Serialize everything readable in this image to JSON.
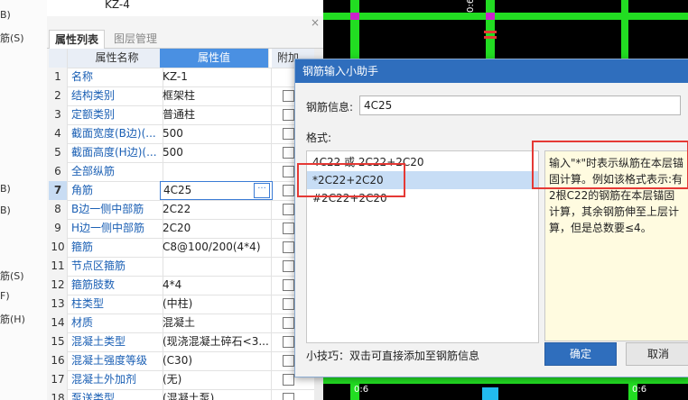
{
  "left_strip": [
    "B)",
    "筋(S)",
    "B)",
    "B)",
    "筋(S)",
    "F)",
    "筋(H)"
  ],
  "panel": {
    "top_item": "KZ-4",
    "close_glyph": "×",
    "tabs": [
      {
        "label": "属性列表"
      },
      {
        "label": "图层管理"
      }
    ],
    "header": {
      "name": "属性名称",
      "value": "属性值",
      "extra": "附加"
    },
    "rows": [
      {
        "num": "1",
        "name": "名称",
        "value": "KZ-1",
        "check": false
      },
      {
        "num": "2",
        "name": "结构类别",
        "value": "框架柱",
        "check": true
      },
      {
        "num": "3",
        "name": "定额类别",
        "value": "普通柱",
        "check": true
      },
      {
        "num": "4",
        "name": "截面宽度(B边)(...",
        "value": "500",
        "check": true
      },
      {
        "num": "5",
        "name": "截面高度(H边)(...",
        "value": "500",
        "check": true
      },
      {
        "num": "6",
        "name": "全部纵筋",
        "value": "",
        "check": true
      },
      {
        "num": "7",
        "name": "角筋",
        "value": "4C25",
        "check": true
      },
      {
        "num": "8",
        "name": "B边一侧中部筋",
        "value": "2C22",
        "check": true
      },
      {
        "num": "9",
        "name": "H边一侧中部筋",
        "value": "2C20",
        "check": true
      },
      {
        "num": "10",
        "name": "箍筋",
        "value": "C8@100/200(4*4)",
        "check": true
      },
      {
        "num": "11",
        "name": "节点区箍筋",
        "value": "",
        "check": true
      },
      {
        "num": "12",
        "name": "箍筋肢数",
        "value": "4*4",
        "check": true
      },
      {
        "num": "13",
        "name": "柱类型",
        "value": "(中柱)",
        "check": true
      },
      {
        "num": "14",
        "name": "材质",
        "value": "混凝土",
        "check": true
      },
      {
        "num": "15",
        "name": "混凝土类型",
        "value": "(现浇混凝土碎石<3...",
        "check": true
      },
      {
        "num": "16",
        "name": "混凝土强度等级",
        "value": "(C30)",
        "check": true
      },
      {
        "num": "17",
        "name": "混凝土外加剂",
        "value": "(无)",
        "check": true
      },
      {
        "num": "18",
        "name": "泵送类型",
        "value": "(混凝土泵)",
        "check": true
      }
    ],
    "ellipsis": "···"
  },
  "cad": {
    "labels": [
      "0:6",
      "0:6",
      "0:6"
    ]
  },
  "dialog": {
    "title": "钢筋输入小助手",
    "info_label": "钢筋信息:",
    "info_value": "4C25",
    "format_label": "格式:",
    "formats": [
      "4C22 或 2C22+2C20",
      "*2C22+2C20",
      "#2C22+2C20"
    ],
    "description": "输入\"*\"时表示纵筋在本层锚固计算。例如该格式表示:有2根C22的钢筋在本层锚固计算，其余钢筋伸至上层计算，但是总数要≤4。",
    "tip": "小技巧：双击可直接添加至钢筋信息",
    "ok": "确定",
    "cancel": "取消"
  },
  "colors": {
    "accent": "#2f6ebd",
    "highlight": "#e53935",
    "cad_green": "#22dd22"
  }
}
